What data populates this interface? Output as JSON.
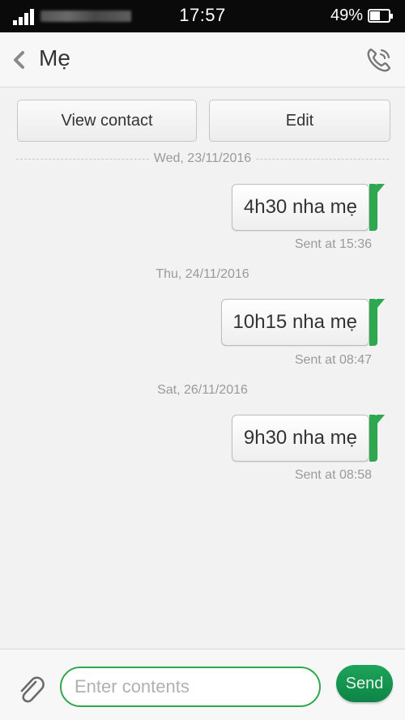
{
  "status_bar": {
    "time": "17:57",
    "battery_percent": "49%",
    "battery_level": 0.49,
    "signal_icon": "signal-bars-icon"
  },
  "header": {
    "contact_name": "Mẹ",
    "back_icon": "chevron-left-icon",
    "call_icon": "phone-icon"
  },
  "actions": {
    "view_contact": "View contact",
    "edit": "Edit"
  },
  "conversation": [
    {
      "date": "Wed, 23/11/2016",
      "message": "4h30 nha mẹ",
      "sent_at": "Sent at 15:36"
    },
    {
      "date": "Thu, 24/11/2016",
      "message": "10h15 nha mẹ",
      "sent_at": "Sent at 08:47"
    },
    {
      "date": "Sat, 26/11/2016",
      "message": "9h30 nha mẹ",
      "sent_at": "Sent at 08:58"
    }
  ],
  "composer": {
    "placeholder": "Enter contents",
    "value": "",
    "send_label": "Send",
    "attach_icon": "paperclip-icon"
  },
  "colors": {
    "accent": "#2ea84f",
    "send_button": "#138c4e",
    "status_bar": "#0a0a0a"
  }
}
